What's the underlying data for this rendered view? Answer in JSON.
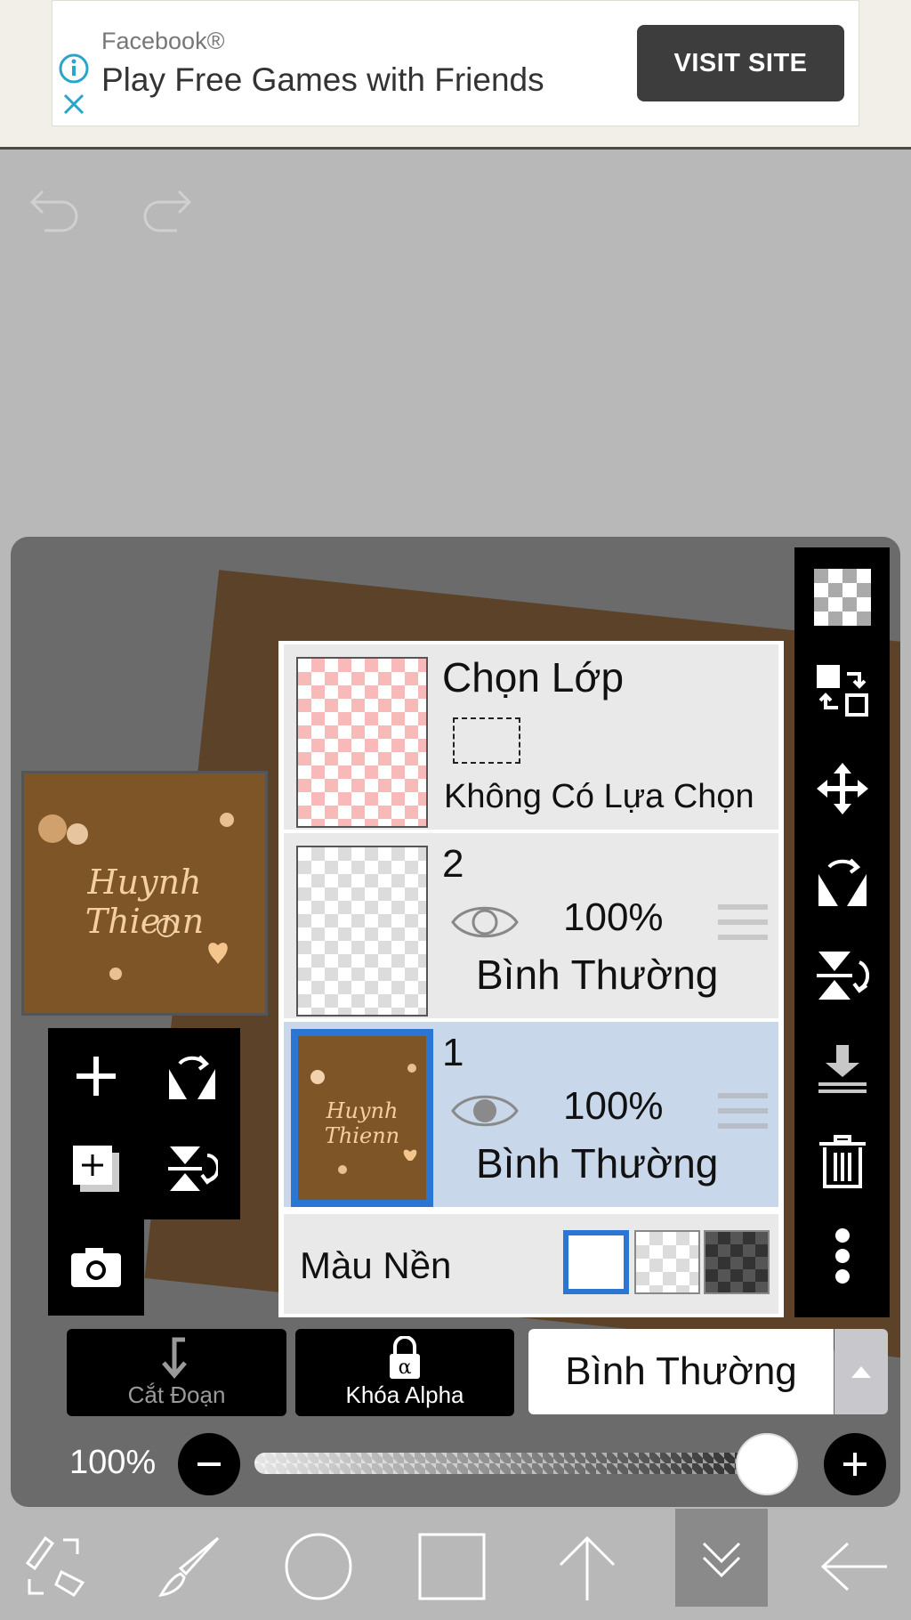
{
  "ad": {
    "source": "Facebook®",
    "title": "Play Free Games with Friends",
    "cta": "VISIT SITE"
  },
  "canvas_preview_text": "Huynh Thienn",
  "layers_panel": {
    "selection_layer": {
      "title": "Chọn Lớp",
      "status": "Không Có Lựa Chọn"
    },
    "layers": [
      {
        "name": "2",
        "opacity": "100%",
        "blend": "Bình Thường",
        "selected": false
      },
      {
        "name": "1",
        "opacity": "100%",
        "blend": "Bình Thường",
        "selected": true
      }
    ],
    "background": {
      "label": "Màu Nền",
      "options": [
        "white",
        "checker",
        "dark"
      ]
    }
  },
  "controls": {
    "clip_label": "Cắt Đoạn",
    "alpha_lock_label": "Khóa Alpha",
    "blend_mode": "Bình Thường",
    "opacity_label": "100%",
    "opacity_value": 1.0
  },
  "colors": {
    "accent": "#2a76d2",
    "panel": "#6b6b6b",
    "toolbar": "#000000"
  },
  "icons": {
    "right_toolbar": [
      "checker-icon",
      "swap-layers-icon",
      "move-icon",
      "flip-horizontal-icon",
      "flip-vertical-icon",
      "merge-down-icon",
      "trash-icon",
      "more-icon"
    ],
    "bottom_toolbar": [
      "transform-icon",
      "brush-icon",
      "circle-icon",
      "square-icon",
      "arrow-up-icon",
      "chevron-double-down-icon",
      "back-arrow-icon"
    ]
  }
}
